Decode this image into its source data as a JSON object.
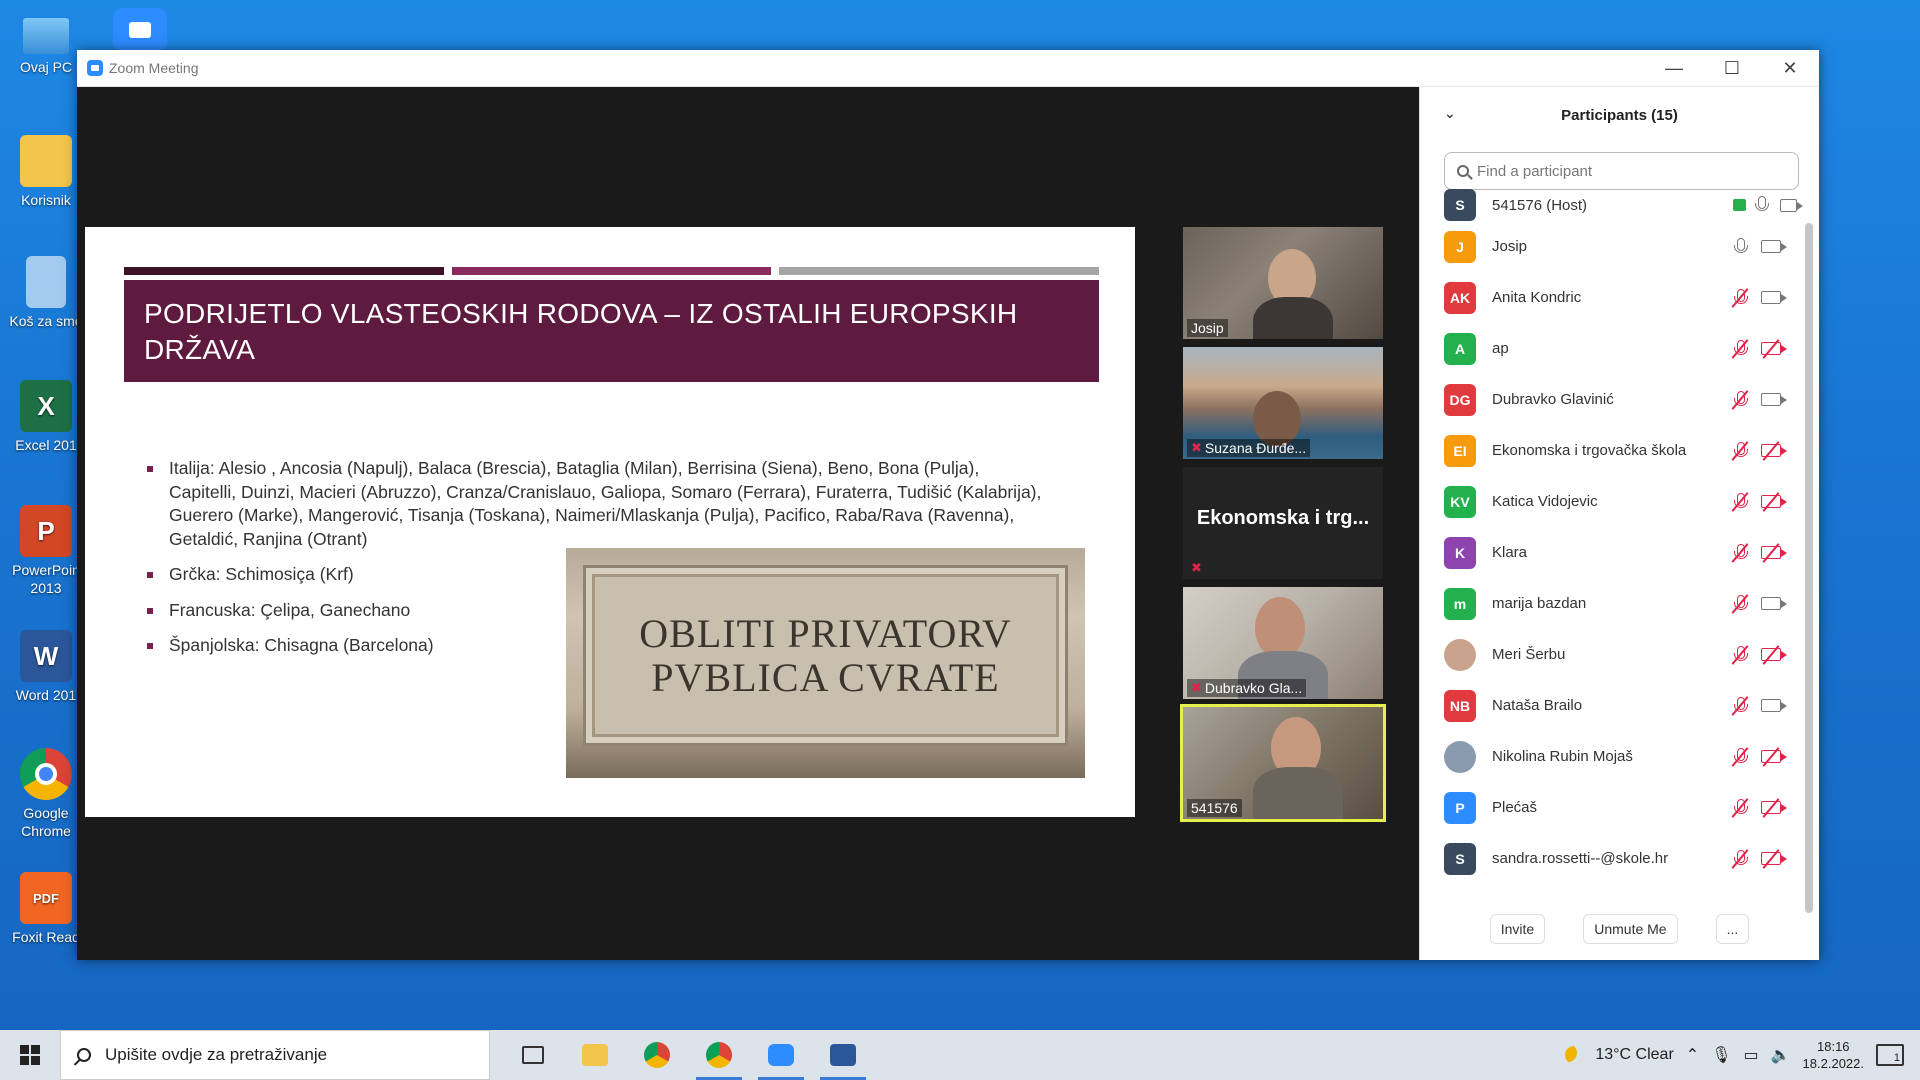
{
  "desktop": {
    "icons": [
      {
        "label": "Ovaj PC"
      },
      {
        "label": "Korisnik"
      },
      {
        "label": "Koš za sme"
      },
      {
        "label": "Excel 201"
      },
      {
        "label": "PowerPoin"
      },
      {
        "label": "2013"
      },
      {
        "label": "Word 201"
      },
      {
        "label": "Google"
      },
      {
        "label": "Chrome"
      },
      {
        "label": "Foxit Read"
      }
    ]
  },
  "window": {
    "title": "Zoom Meeting",
    "minimize": "—",
    "maximize": "☐",
    "close": "✕"
  },
  "slide": {
    "title": "PODRIJETLO VLASTEOSKIH RODOVA – IZ OSTALIH EUROPSKIH DRŽAVA",
    "stripe_colors": [
      "#3d1228",
      "#8a2b5f",
      "#a6a6a6"
    ],
    "bullets": [
      "Italija: Alesio , Ancosia (Napulj), Balaca (Brescia), Bataglia (Milan), Berrisina (Siena), Beno, Bona (Pulja), Capitelli, Duinzi, Macieri (Abruzzo), Cranza/Cranislauo, Galiopa, Somaro (Ferrara), Furaterra, Tudišić (Kalabrija), Guerero (Marke), Mangerović, Tisanja (Toskana), Naimeri/Mlaskanja (Pulja), Pacifico, Raba/Rava (Ravenna), Getaldić, Ranjina (Otrant)",
      "Grčka: Schimosiça (Krf)",
      "Francuska: Çelipa, Ganechano",
      "Španjolska: Chisagna (Barcelona)"
    ],
    "inscription": {
      "line1": "OBLITI PRIVATORV",
      "line2": "PVBLICA CVRATE"
    }
  },
  "video_tiles": [
    {
      "name": "Josip",
      "muted": false
    },
    {
      "name": "Suzana Đurđe...",
      "muted": true
    },
    {
      "name": "Ekonomska i trg...",
      "muted": true
    },
    {
      "name": "Dubravko Gla...",
      "muted": true
    },
    {
      "name": "541576",
      "muted": false
    }
  ],
  "participants_panel": {
    "title": "Participants (15)",
    "search_placeholder": "Find a participant",
    "participants": [
      {
        "initials": "S",
        "name": "541576 (Host)",
        "color": "#3a4a5e",
        "mic": "on",
        "cam": "on"
      },
      {
        "initials": "J",
        "name": "Josip",
        "color": "#f59b0c",
        "mic": "on",
        "cam": "on"
      },
      {
        "initials": "AK",
        "name": "Anita Kondric",
        "color": "#e0393e",
        "mic": "off",
        "cam": "on"
      },
      {
        "initials": "A",
        "name": "ap",
        "color": "#23b14d",
        "mic": "off",
        "cam": "off"
      },
      {
        "initials": "DG",
        "name": "Dubravko Glavinić",
        "color": "#e0393e",
        "mic": "off",
        "cam": "on"
      },
      {
        "initials": "EI",
        "name": "Ekonomska i trgovačka škola",
        "color": "#f59b0c",
        "mic": "off",
        "cam": "off"
      },
      {
        "initials": "KV",
        "name": "Katica Vidojevic",
        "color": "#23b14d",
        "mic": "off",
        "cam": "off"
      },
      {
        "initials": "K",
        "name": "Klara",
        "color": "#8e44ad",
        "mic": "off",
        "cam": "off"
      },
      {
        "initials": "m",
        "name": "marija bazdan",
        "color": "#23b14d",
        "mic": "off",
        "cam": "on"
      },
      {
        "initials": "",
        "name": "Meri Šerbu",
        "color": "#c9a38c",
        "mic": "off",
        "cam": "off"
      },
      {
        "initials": "NB",
        "name": "Nataša Brailo",
        "color": "#e0393e",
        "mic": "off",
        "cam": "on"
      },
      {
        "initials": "",
        "name": "Nikolina Rubin Mojaš",
        "color": "#8a9bb0",
        "mic": "off",
        "cam": "off"
      },
      {
        "initials": "P",
        "name": "Plećaš",
        "color": "#2d8cff",
        "mic": "off",
        "cam": "off"
      },
      {
        "initials": "S",
        "name": "sandra.rossetti--@skole.hr",
        "color": "#3a4a5e",
        "mic": "off",
        "cam": "off"
      }
    ],
    "buttons": {
      "invite": "Invite",
      "unmute": "Unmute Me",
      "more": "..."
    }
  },
  "taskbar": {
    "search_text": "Upišite ovdje za pretraživanje",
    "weather": "13°C  Clear",
    "time": "18:16",
    "date": "18.2.2022.",
    "notifications": "1"
  }
}
